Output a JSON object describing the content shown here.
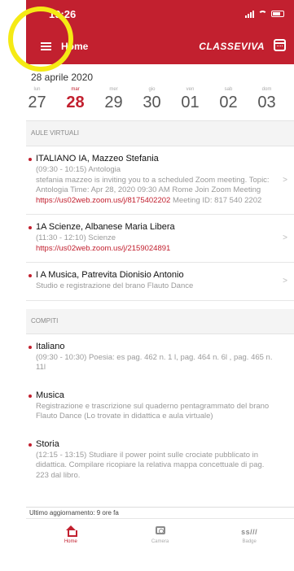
{
  "status": {
    "time": "19:26"
  },
  "header": {
    "title": "Home",
    "logo": "CLASSEVIVA"
  },
  "date": {
    "label": "28 aprile 2020",
    "days": [
      {
        "name": "lun",
        "num": "27"
      },
      {
        "name": "mar",
        "num": "28",
        "selected": true
      },
      {
        "name": "mer",
        "num": "29"
      },
      {
        "name": "gio",
        "num": "30"
      },
      {
        "name": "ven",
        "num": "01"
      },
      {
        "name": "sab",
        "num": "02"
      },
      {
        "name": "dom",
        "num": "03"
      }
    ]
  },
  "aule": {
    "heading": "AULE VIRTUALI",
    "items": [
      {
        "title": "ITALIANO IA, Mazzeo Stefania",
        "line1": "(09:30 - 10:15) Antologia",
        "line2": "stefania mazzeo is inviting you to a scheduled Zoom meeting. Topic: Antologia Time: Apr 28, 2020 09:30 AM Rome Join Zoom Meeting",
        "link": "https://us02web.zoom.us/j/8175402202",
        "line3": " Meeting ID: 817 540 2202"
      },
      {
        "title": "1A Scienze, Albanese Maria Libera",
        "line1": "(11:30 - 12:10) Scienze",
        "link": "https://us02web.zoom.us/j/2159024891"
      },
      {
        "title": "I A Musica, Patrevita Dionisio Antonio",
        "line1": "Studio e registrazione del brano Flauto Dance"
      }
    ]
  },
  "compiti": {
    "heading": "COMPITI",
    "items": [
      {
        "title": "Italiano",
        "body": "(09:30 - 10:30) Poesia: es pag. 462 n. 1 l, pag. 464 n. 6l , pag. 465 n. 11l"
      },
      {
        "title": "Musica",
        "body": "Registrazione e trascrizione sul quaderno pentagrammato del brano Flauto Dance (Lo trovate in didattica e aula virtuale)"
      },
      {
        "title": "Storia",
        "body": "(12:15 - 13:15) Studiare il power point sulle crociate pubblicato in didattica. Compilare ricopiare la relativa mappa concettuale di pag. 223 dal libro."
      }
    ]
  },
  "footer": {
    "update": "Ultimo aggiornamento: 9 ore fa"
  },
  "tabs": [
    {
      "label": "Home",
      "icon": "home-icon"
    },
    {
      "label": "Camera",
      "icon": "camera-icon"
    },
    {
      "label": "Badge",
      "icon": "badge-icon",
      "glyph": "ss///"
    }
  ],
  "colors": {
    "accent": "#c2202f",
    "highlight": "#f5ea14"
  }
}
